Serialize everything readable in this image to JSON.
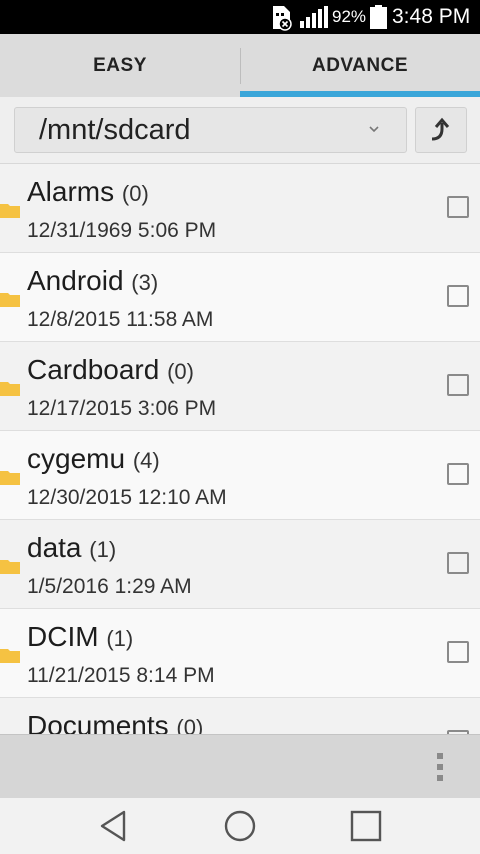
{
  "status_bar": {
    "battery_percent": "92%",
    "time": "3:48 PM",
    "icons": [
      "sim-error-icon",
      "signal-icon",
      "battery-icon"
    ]
  },
  "tabs": [
    {
      "label": "EASY",
      "selected": false
    },
    {
      "label": "ADVANCE",
      "selected": true
    }
  ],
  "accent_color": "#3aa6d9",
  "folder_color": "#f5c242",
  "path": {
    "value": "/mnt/sdcard"
  },
  "files": [
    {
      "name": "Alarms",
      "count": "(0)",
      "date": "12/31/1969 5:06 PM",
      "checked": false
    },
    {
      "name": "Android",
      "count": "(3)",
      "date": "12/8/2015 11:58 AM",
      "checked": false
    },
    {
      "name": "Cardboard",
      "count": "(0)",
      "date": "12/17/2015 3:06 PM",
      "checked": false
    },
    {
      "name": "cygemu",
      "count": "(4)",
      "date": "12/30/2015 12:10 AM",
      "checked": false
    },
    {
      "name": "data",
      "count": "(1)",
      "date": "1/5/2016 1:29 AM",
      "checked": false
    },
    {
      "name": "DCIM",
      "count": "(1)",
      "date": "11/21/2015 8:14 PM",
      "checked": false
    },
    {
      "name": "Documents",
      "count": "(0)",
      "date": "",
      "checked": false
    }
  ]
}
